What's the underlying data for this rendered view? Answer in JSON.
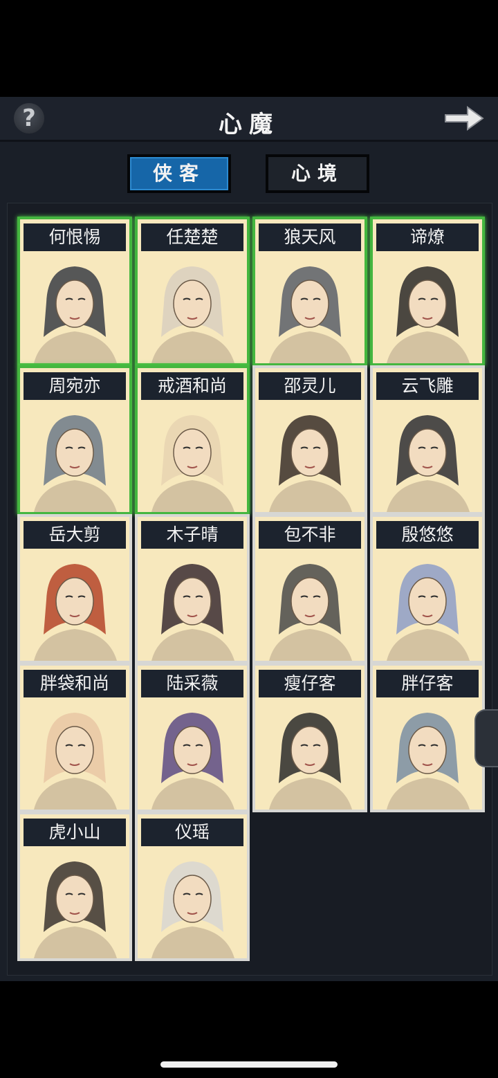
{
  "header": {
    "title": "心魔",
    "help_label": "?"
  },
  "tabs": [
    {
      "label": "侠客",
      "active": true
    },
    {
      "label": "心境",
      "active": false
    }
  ],
  "characters": [
    {
      "name": "何恨惕",
      "owned": true
    },
    {
      "name": "任楚楚",
      "owned": true
    },
    {
      "name": "狼天风",
      "owned": true
    },
    {
      "name": "谛燎",
      "owned": true
    },
    {
      "name": "周宛亦",
      "owned": true
    },
    {
      "name": "戒酒和尚",
      "owned": true
    },
    {
      "name": "邵灵儿",
      "owned": false
    },
    {
      "name": "云飞雕",
      "owned": false
    },
    {
      "name": "岳大剪",
      "owned": false
    },
    {
      "name": "木子晴",
      "owned": false
    },
    {
      "name": "包不非",
      "owned": false
    },
    {
      "name": "殷悠悠",
      "owned": false
    },
    {
      "name": "胖袋和尚",
      "owned": false
    },
    {
      "name": "陆采薇",
      "owned": false
    },
    {
      "name": "瘦仔客",
      "owned": false
    },
    {
      "name": "胖仔客",
      "owned": false
    },
    {
      "name": "虎小山",
      "owned": false
    },
    {
      "name": "仪瑶",
      "owned": false
    }
  ],
  "colors": {
    "owned_border": "#44b63f",
    "tab_active": "#1666a8",
    "card_bg": "#f7e8bd"
  }
}
